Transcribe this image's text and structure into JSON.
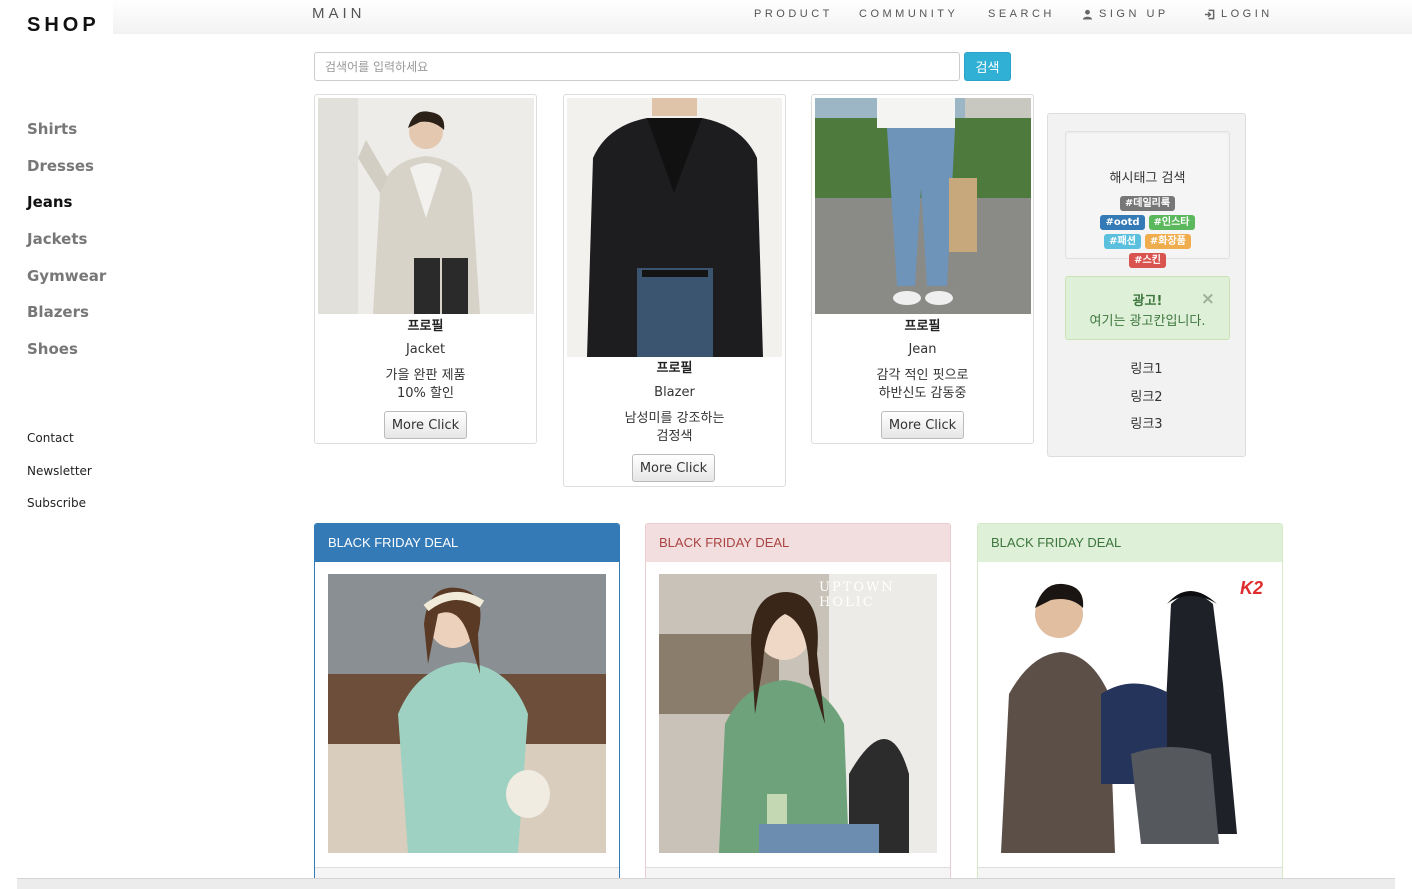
{
  "brand": "SHOP",
  "sidebar": {
    "categories": [
      "Shirts",
      "Dresses",
      "Jeans",
      "Jackets",
      "Gymwear",
      "Blazers",
      "Shoes"
    ],
    "active_category": "Jeans",
    "footer_links": [
      "Contact",
      "Newsletter",
      "Subscribe"
    ]
  },
  "nav": {
    "main": "MAIN",
    "product": "PRODUCT",
    "community": "COMMUNITY",
    "search": "SEARCH",
    "signup": "SIGN UP",
    "login": "LOGIN",
    "signup_icon": "user-icon",
    "login_icon": "login-icon"
  },
  "search": {
    "placeholder": "검색어를 입력하세요",
    "button": "검색"
  },
  "products": [
    {
      "title": "프로필",
      "name": "Jacket",
      "desc1": "가을 완판 제품",
      "desc2": "10% 할인",
      "button": "More Click"
    },
    {
      "title": "프로필",
      "name": "Blazer",
      "desc1": "남성미를 강조하는",
      "desc2": "검정색",
      "button": "More Click"
    },
    {
      "title": "프로필",
      "name": "Jean",
      "desc1": "감각 적인 핏으로",
      "desc2": "하반신도 감동중",
      "button": "More Click"
    }
  ],
  "hashtags": {
    "title": "해시태그 검색",
    "tags": [
      {
        "label": "#데일리룩",
        "color": "#777777"
      },
      {
        "label": "#ootd",
        "color": "#337ab7"
      },
      {
        "label": "#인스타",
        "color": "#5cb85c"
      },
      {
        "label": "#패션",
        "color": "#5bc0de"
      },
      {
        "label": "#화장품",
        "color": "#f0ad4e"
      },
      {
        "label": "#스킨",
        "color": "#d9534f"
      }
    ]
  },
  "ad": {
    "title": "광고!",
    "text": "여기는 광고칸입니다.",
    "close": "×"
  },
  "links": [
    "링크1",
    "링크2",
    "링크3"
  ],
  "deals": [
    {
      "label": "BLACK FRIDAY DEAL",
      "style": "primary",
      "head_bg": "#337ab7",
      "head_color": "#ffffff",
      "border": "#337ab7"
    },
    {
      "label": "BLACK FRIDAY DEAL",
      "style": "danger",
      "head_bg": "#f2dede",
      "head_color": "#a94442",
      "border": "#ebccd1"
    },
    {
      "label": "BLACK FRIDAY DEAL",
      "style": "success",
      "head_bg": "#dff0d8",
      "head_color": "#3c763d",
      "border": "#d6e9c6"
    }
  ],
  "deal_images": {
    "watermark": "UPTOWN HOLIC",
    "logo": "K2"
  }
}
